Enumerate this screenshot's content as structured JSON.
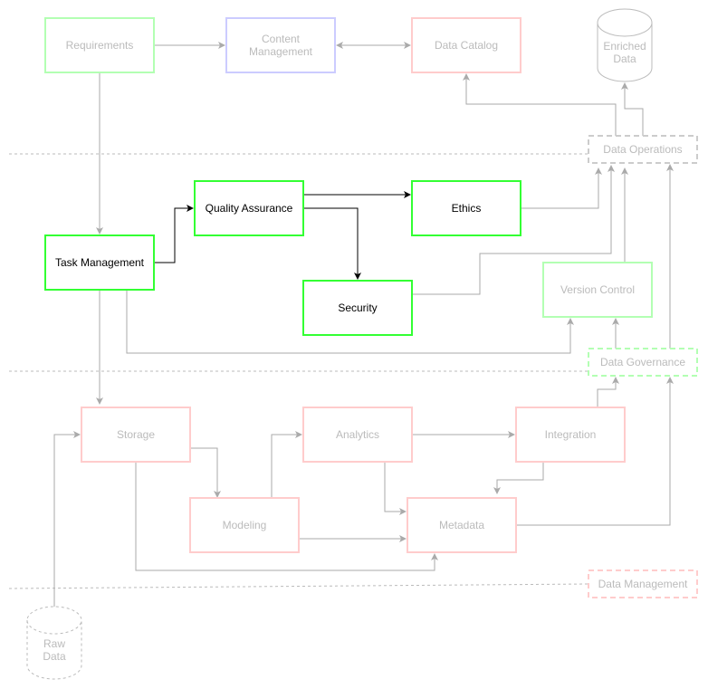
{
  "colors": {
    "faded_text": "#bbbbbb",
    "active_text": "#000000",
    "active_stroke": "#33ff33",
    "faded_green": "#b3ffb3",
    "faded_blue": "#ccccff",
    "faded_red": "#ffcccc",
    "faded_gray": "#cccccc",
    "edge_faded": "#aaaaaa",
    "edge_active": "#000000"
  },
  "nodes": [
    {
      "id": "requirements",
      "label": "Requirements",
      "style": "faded_green"
    },
    {
      "id": "content",
      "label": "Content Management",
      "style": "faded_blue"
    },
    {
      "id": "catalog",
      "label": "Data Catalog",
      "style": "faded_red"
    },
    {
      "id": "enriched",
      "label": "Enriched Data",
      "style": "cylinder"
    },
    {
      "id": "dataops",
      "label": "Data Operations",
      "style": "dashed_gray"
    },
    {
      "id": "qa",
      "label": "Quality Assurance",
      "style": "active"
    },
    {
      "id": "ethics",
      "label": "Ethics",
      "style": "active"
    },
    {
      "id": "task",
      "label": "Task Management",
      "style": "active"
    },
    {
      "id": "security",
      "label": "Security",
      "style": "active"
    },
    {
      "id": "version",
      "label": "Version Control",
      "style": "faded_green"
    },
    {
      "id": "datagov",
      "label": "Data Governance",
      "style": "dashed_green"
    },
    {
      "id": "storage",
      "label": "Storage",
      "style": "faded_red"
    },
    {
      "id": "analytics",
      "label": "Analytics",
      "style": "faded_red"
    },
    {
      "id": "integration",
      "label": "Integration",
      "style": "faded_red"
    },
    {
      "id": "modeling",
      "label": "Modeling",
      "style": "faded_red"
    },
    {
      "id": "metadata",
      "label": "Metadata",
      "style": "faded_red"
    },
    {
      "id": "datamgmt",
      "label": "Data Management",
      "style": "dashed_red"
    },
    {
      "id": "raw",
      "label": "Raw Data",
      "style": "cylinder_dashed"
    }
  ],
  "edges": [
    {
      "from": "requirements",
      "to": "content"
    },
    {
      "from": "content",
      "to": "catalog",
      "bidirectional": true
    },
    {
      "from": "requirements",
      "to": "task"
    },
    {
      "from": "dataops",
      "to": "catalog"
    },
    {
      "from": "dataops",
      "to": "enriched"
    },
    {
      "from": "task",
      "to": "qa",
      "active": true
    },
    {
      "from": "qa",
      "to": "ethics",
      "active": true
    },
    {
      "from": "qa",
      "to": "security",
      "active": true
    },
    {
      "from": "ethics",
      "to": "dataops"
    },
    {
      "from": "security",
      "to": "dataops"
    },
    {
      "from": "version",
      "to": "dataops"
    },
    {
      "from": "datagov",
      "to": "dataops"
    },
    {
      "from": "task",
      "to": "version"
    },
    {
      "from": "datagov",
      "to": "version"
    },
    {
      "from": "task",
      "to": "storage"
    },
    {
      "from": "raw",
      "to": "storage"
    },
    {
      "from": "storage",
      "to": "modeling"
    },
    {
      "from": "modeling",
      "to": "analytics"
    },
    {
      "from": "analytics",
      "to": "integration"
    },
    {
      "from": "integration",
      "to": "datagov"
    },
    {
      "from": "integration",
      "to": "metadata"
    },
    {
      "from": "analytics",
      "to": "metadata"
    },
    {
      "from": "modeling",
      "to": "metadata"
    },
    {
      "from": "storage",
      "to": "metadata"
    },
    {
      "from": "metadata",
      "to": "datagov"
    }
  ]
}
